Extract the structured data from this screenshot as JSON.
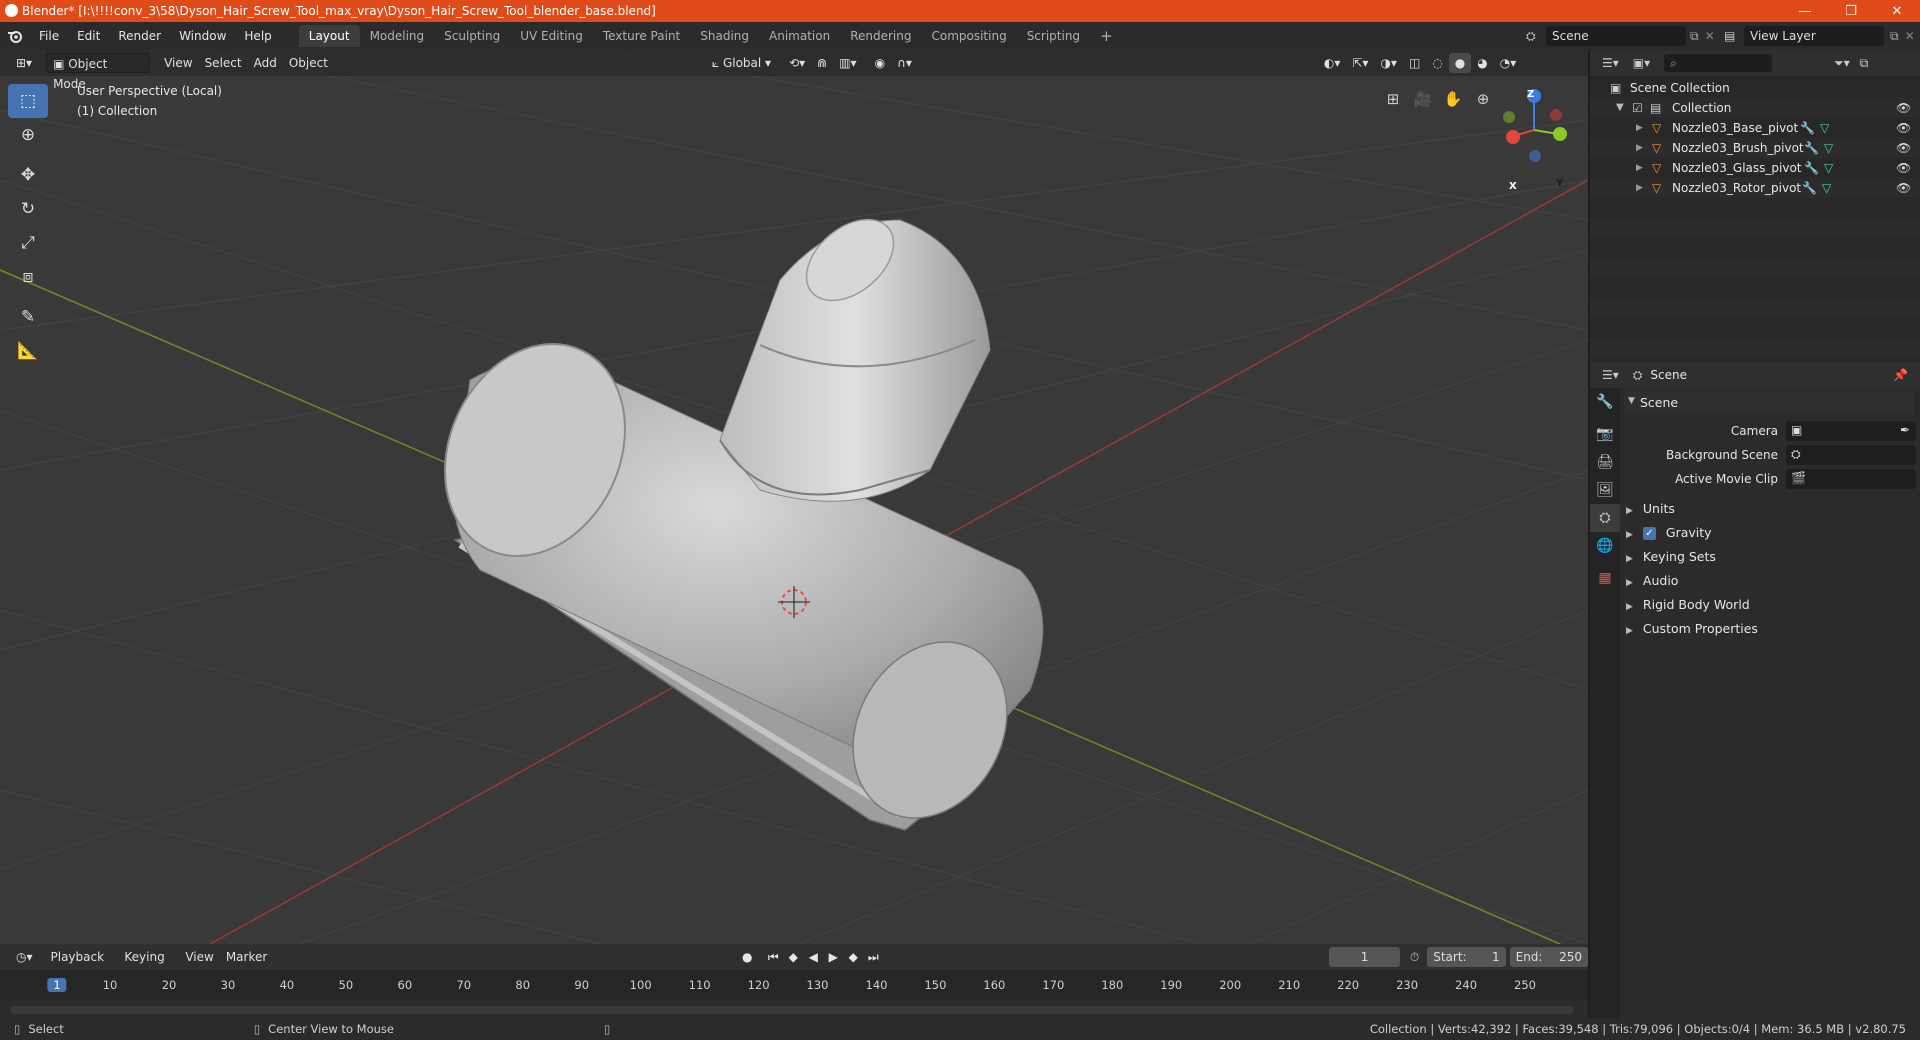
{
  "window": {
    "title": "Blender* [I:\\!!!!conv_3\\58\\Dyson_Hair_Screw_Tool_max_vray\\Dyson_Hair_Screw_Tool_blender_base.blend]",
    "controls": {
      "minimize": "—",
      "restore": "❐",
      "close": "✕"
    }
  },
  "menubar": {
    "items": [
      "File",
      "Edit",
      "Render",
      "Window",
      "Help"
    ]
  },
  "workspaces": {
    "tabs": [
      "Layout",
      "Modeling",
      "Sculpting",
      "UV Editing",
      "Texture Paint",
      "Shading",
      "Animation",
      "Rendering",
      "Compositing",
      "Scripting"
    ],
    "active": "Layout",
    "add": "+"
  },
  "scene_selector": {
    "value": "Scene"
  },
  "view_layer_selector": {
    "value": "View Layer"
  },
  "viewport": {
    "mode": "Object Mode",
    "menus": [
      "View",
      "Select",
      "Add",
      "Object"
    ],
    "transform_orientation": "Global",
    "overlay_line1": "User Perspective (Local)",
    "overlay_line2": "(1) Collection",
    "gizmo_axes": {
      "x": "X",
      "y": "Y",
      "z": "Z"
    }
  },
  "outliner": {
    "search_placeholder": "",
    "root": "Scene Collection",
    "collection": "Collection",
    "objects": [
      "Nozzle03_Base_pivot",
      "Nozzle03_Brush_pivot",
      "Nozzle03_Glass_pivot",
      "Nozzle03_Rotor_pivot"
    ]
  },
  "properties": {
    "header_title": "Scene",
    "panel_title": "Scene",
    "camera_label": "Camera",
    "background_scene_label": "Background Scene",
    "active_movie_clip_label": "Active Movie Clip",
    "subpanels": [
      "Units",
      "Gravity",
      "Keying Sets",
      "Audio",
      "Rigid Body World",
      "Custom Properties"
    ],
    "gravity_checked": true
  },
  "timeline": {
    "menus": [
      "Playback",
      "Keying",
      "View",
      "Marker"
    ],
    "current_frame": "1",
    "start_label": "Start:",
    "start_value": "1",
    "end_label": "End:",
    "end_value": "250",
    "ruler_marks": [
      "1",
      "10",
      "20",
      "30",
      "40",
      "50",
      "60",
      "70",
      "80",
      "90",
      "100",
      "110",
      "120",
      "130",
      "140",
      "150",
      "160",
      "170",
      "180",
      "190",
      "200",
      "210",
      "220",
      "230",
      "240",
      "250"
    ]
  },
  "statusbar": {
    "left_action": "Select",
    "middle_action": "Center View to Mouse",
    "stats": "Collection | Verts:42,392 | Faces:39,548 | Tris:79,096 | Objects:0/4 | Mem: 36.5 MB | v2.80.75"
  },
  "colors": {
    "title_bar": "#e04b1a",
    "accent": "#4772b3",
    "axis_x": "#e2463c",
    "axis_y": "#8ac926",
    "axis_z": "#3c7be2"
  }
}
